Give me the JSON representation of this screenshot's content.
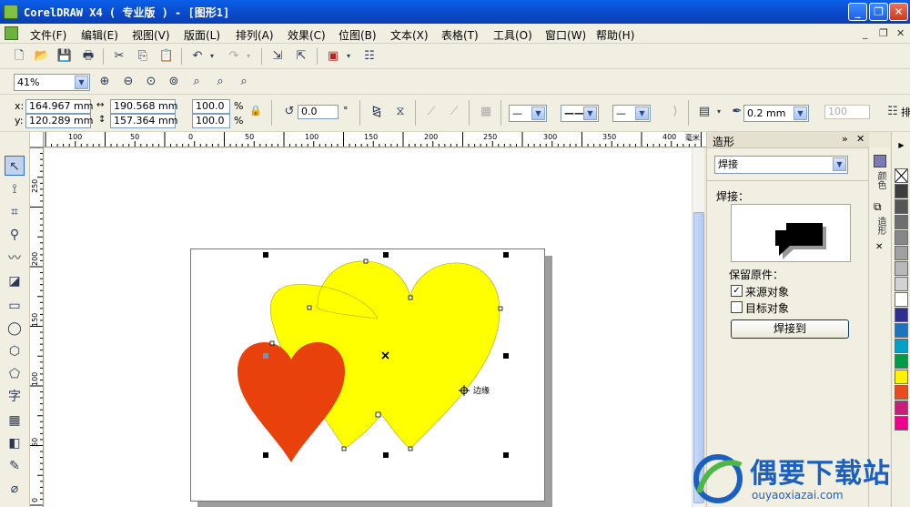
{
  "window": {
    "title": "CorelDRAW X4 ( 专业版 ) - [图形1]",
    "minimize": "_",
    "restore": "❐",
    "close": "✕"
  },
  "menu": {
    "items": [
      "文件(F)",
      "编辑(E)",
      "视图(V)",
      "版面(L)",
      "排列(A)",
      "效果(C)",
      "位图(B)",
      "文本(X)",
      "表格(T)",
      "工具(O)",
      "窗口(W)",
      "帮助(H)"
    ],
    "mdi_min": "_",
    "mdi_restore": "❐",
    "mdi_close": "✕"
  },
  "zoom": {
    "value": "41%"
  },
  "property_bar": {
    "x_label": "x:",
    "x_value": "164.967 mm",
    "y_label": "y:",
    "y_value": "120.289 mm",
    "width_value": "190.568 mm",
    "height_value": "157.364 mm",
    "scale_w": "100.0",
    "scale_h": "100.0",
    "percent": "%",
    "angle_value": "0.0",
    "degree": "°",
    "outline_width": "0.2 mm",
    "outline_disabled_value": "100",
    "overflow_label": "排"
  },
  "ruler": {
    "h_ticks": [
      "100",
      "50",
      "0",
      "50",
      "100",
      "150",
      "200",
      "250",
      "300",
      "350",
      "400"
    ],
    "h_unit": "毫米",
    "v_ticks": [
      "250",
      "200",
      "150",
      "100",
      "50",
      "0"
    ]
  },
  "canvas": {
    "cursor_label": "边缘",
    "colors": {
      "yellow": "#ffff00",
      "red": "#e8410b",
      "page_shadow": "#9c9c9c"
    }
  },
  "docker": {
    "title": "造形",
    "mode_value": "焊接",
    "section_label": "焊接：",
    "keep_label": "保留原件：",
    "source_label": "来源对象",
    "source_checked": true,
    "target_label": "目标对象",
    "target_checked": false,
    "apply_button": "焊接到"
  },
  "side_tabs": {
    "tab1": "颜色",
    "tab2": "造形"
  },
  "palette": {
    "colors": [
      "#3d3d3d",
      "#565656",
      "#6e6e6e",
      "#878787",
      "#a0a0a0",
      "#b9b9b9",
      "#d2d2d2",
      "#ffffff",
      "#2e2e8f",
      "#1e73be",
      "#00a0c6",
      "#009b48",
      "#fff200",
      "#e54d1f",
      "#c51f7a",
      "#ec008c"
    ]
  },
  "watermark": {
    "brand": "偶要下载站",
    "url": "ouyaoxiazai.com"
  }
}
